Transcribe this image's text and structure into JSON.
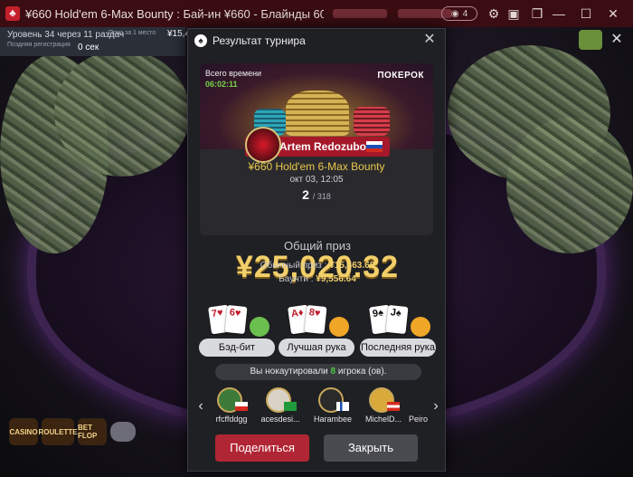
{
  "window": {
    "title": "¥660 Hold'em 6-Max Bounty : Бай-ин ¥660 - Блайнды 60,000 | 120...",
    "eye_count": "4"
  },
  "infostrip": {
    "level": "Уровень 34 через 11 раздач",
    "registration": "Поздняя регистрация",
    "timer": "0 сек",
    "prize_label": "Приз за 1 место",
    "amount": "¥15,4"
  },
  "modal": {
    "title": "Результат турнира",
    "banner": {
      "alltime_label": "Всего времени",
      "alltime_timer": "06:02:11",
      "brand": "ПОКЕРОК",
      "player_name": "Artem Redozubov",
      "tournament_name": "¥660 Hold'em 6-Max Bounty",
      "date": "окт 03, 12:05",
      "place": "2",
      "of_total": "/ 318"
    },
    "total_prize_label": "Общий приз",
    "total_prize_value": "¥25,020.32",
    "regular_prize_label": "Обычный приз :",
    "regular_prize_value": "¥15,463.68",
    "bounty_label": "Баунти :",
    "bounty_value": "¥9,556.64",
    "badges": [
      {
        "label": "Бэд-бит",
        "card1": "7♥",
        "card2": "6♥"
      },
      {
        "label": "Лучшая рука",
        "card1": "A♦",
        "card2": "8♥"
      },
      {
        "label": "Последняя рука",
        "card1": "9♠",
        "card2": "J♠"
      }
    ],
    "knockout_text_before": "Вы нокаутировали",
    "knockout_count": "8",
    "knockout_text_after": "игрока (ов).",
    "knocked_players": [
      {
        "name": "rfcffddgg"
      },
      {
        "name": "acesdesi..."
      },
      {
        "name": "Harambee"
      },
      {
        "name": "MichelD..."
      },
      {
        "name": "Peiro"
      }
    ],
    "share_button": "Поделиться",
    "close_button": "Закрыть"
  },
  "colors": {
    "accent_gold": "#f2cf6a",
    "share_red": "#b12634",
    "knockout_green": "#4fc84a"
  }
}
